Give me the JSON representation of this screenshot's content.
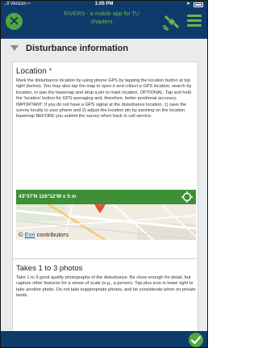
{
  "status_bar": {
    "carrier": "..ll Verizon ≈",
    "time": "1:05 PM",
    "icons": [
      "location-arrow-icon",
      "battery-icon"
    ]
  },
  "header": {
    "title_line1": "RIVERS - a mobile app for TU",
    "title_line2": "chapters",
    "close_icon": "close-icon",
    "gps_icon": "satellite-icon",
    "menu_icon": "menu-icon",
    "accent_color": "#6bb64a",
    "bar_color": "#0f3b6b"
  },
  "section": {
    "title": "Disturbance information"
  },
  "location": {
    "title": "Location",
    "required_mark": "*",
    "description": "Mark the disturbance location by using phone GPS by tapping the location button at top right (below). You may also tap the map to open it and collect a GPS location, search by location, or pan the basemap and drop a pin to mark location. OPTIONAL: Tap and hold the 'location' button for GPS averaging and, therefore, better positional accuracy. IMPORTANT: If you do not have a GPS signal at the disturbance location, 1) save the survey locally to your phone and 2) adjust the location pin by panning on the location basemap BEFORE you submit the survey when back in cell service.",
    "coordinates": "43°37'N 116°12'W ± 5 m",
    "attribution_esri": "Esri",
    "attribution_rest": "contributors",
    "copyright": "©"
  },
  "photos": {
    "title": "Takes 1 to 3 photos",
    "description": "Take 1 to 3 good quality photographs of the disturbance. Be close enough for detail, but capture other features for a sense of scale (e.g., a person). Tap plus icon in lower right to take another photo. Do not take inappropriate photos, and be considerate when on private lands."
  },
  "footer": {
    "submit_icon": "checkmark-icon"
  }
}
